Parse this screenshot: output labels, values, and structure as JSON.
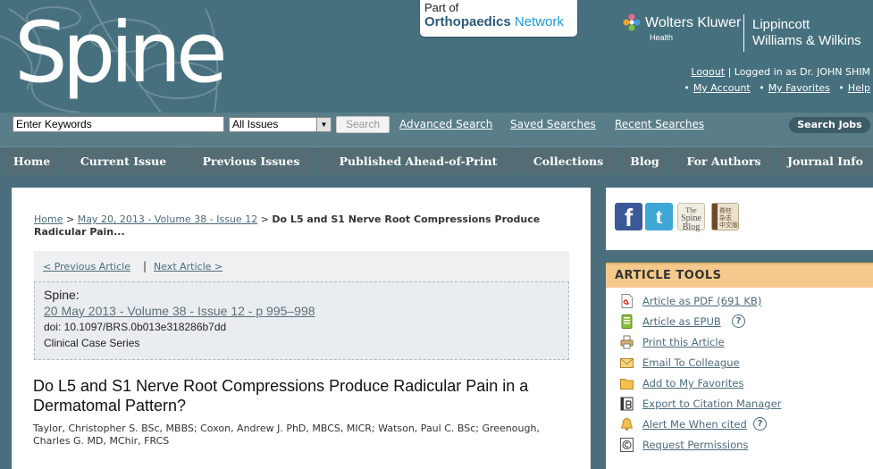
{
  "header": {
    "logo_text": "Spine",
    "network_line1": "Part of",
    "network_line2a": "Orthopaedics",
    "network_line2b": " Network",
    "publisher_name": "Wolters Kluwer",
    "publisher_sub": "Health",
    "imprint_line1": "Lippincott",
    "imprint_line2": "Williams & Wilkins",
    "logout": "Logout",
    "logged_in_text": "| Logged in as Dr. JOHN SHIM",
    "my_account": "My Account",
    "my_favorites": "My Favorites",
    "help": "Help"
  },
  "search": {
    "keyword_value": "Enter Keywords",
    "issue_selected": "All Issues",
    "search_button": "Search",
    "advanced": "Advanced Search",
    "saved": "Saved Searches",
    "recent": "Recent Searches",
    "jobs": "Search Jobs"
  },
  "nav": {
    "items": [
      {
        "label": "Home"
      },
      {
        "label": "Current Issue"
      },
      {
        "label": "Previous Issues"
      },
      {
        "label": "Published Ahead-of-Print"
      },
      {
        "label": "Collections"
      },
      {
        "label": "Blog"
      },
      {
        "label": "For Authors"
      },
      {
        "label": "Journal Info"
      }
    ]
  },
  "breadcrumb": {
    "home": "Home",
    "issue": "May 20, 2013 - Volume 38 - Issue 12",
    "separator": ">",
    "current": "Do L5 and S1 Nerve Root Compressions Produce Radicular Pain..."
  },
  "pager": {
    "previous": "< Previous Article",
    "divider": "|",
    "next": "Next Article >"
  },
  "citation": {
    "journal": "Spine:",
    "issue_link": "20 May 2013 - Volume 38 - Issue 12 - p 995–998",
    "doi": "doi: 10.1097/BRS.0b013e318286b7dd",
    "article_type": "Clinical Case Series"
  },
  "article": {
    "title": "Do L5 and S1 Nerve Root Compressions Produce Radicular Pain in a Dermatomal Pattern?",
    "authors": "Taylor, Christopher S. BSc, MBBS; Coxon, Andrew J. PhD, MBCS, MICR; Watson, Paul C. BSc; Greenough, Charles G. MD, MChir, FRCS"
  },
  "social": {
    "facebook": "f",
    "twitter": "t",
    "blog_line1": "The",
    "blog_line2": "Spine",
    "blog_line3": "Blog",
    "chinese_line1": "脊柱",
    "chinese_line2": "杂志",
    "chinese_line3": "中文版"
  },
  "tools": {
    "header": "ARTICLE TOOLS",
    "help_glyph": "?",
    "items": [
      {
        "label": "Article as PDF (691 KB)",
        "icon": "pdf-icon"
      },
      {
        "label": "Article as EPUB",
        "icon": "epub-icon"
      },
      {
        "label": "Print this Article",
        "icon": "print-icon"
      },
      {
        "label": "Email To Colleague",
        "icon": "email-icon"
      },
      {
        "label": "Add to My Favorites",
        "icon": "folder-icon"
      },
      {
        "label": "Export to Citation Manager",
        "icon": "citation-icon"
      },
      {
        "label": "Alert Me When cited",
        "icon": "bell-icon"
      },
      {
        "label": "Request Permissions",
        "icon": "copyright-icon"
      }
    ]
  }
}
